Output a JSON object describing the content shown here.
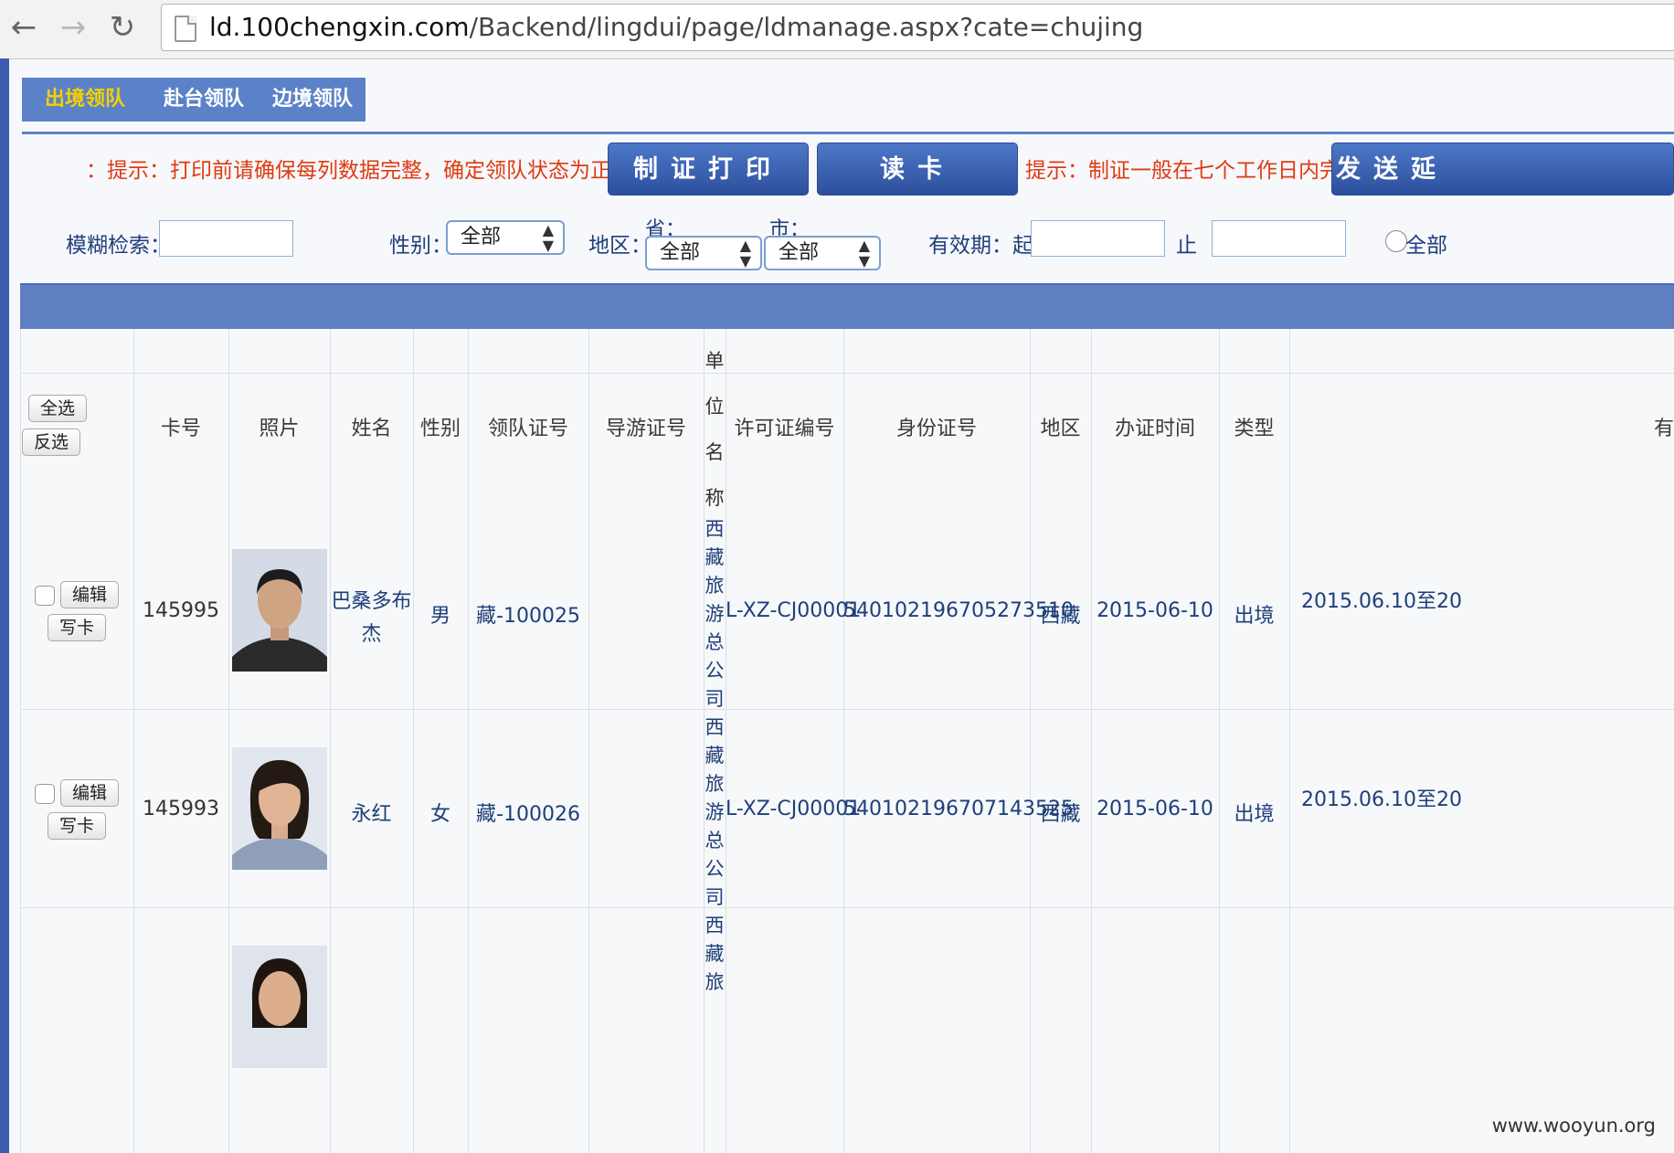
{
  "browser": {
    "back": "←",
    "forward": "→",
    "reload": "↻",
    "url_host": "ld.100chengxin.com",
    "url_path": "/Backend/lingdui/page/ldmanage.aspx?cate=chujing"
  },
  "tabs": [
    {
      "label": "出境领队",
      "active": true
    },
    {
      "label": "赴台领队",
      "active": false
    },
    {
      "label": "边境领队",
      "active": false
    }
  ],
  "tips": {
    "print_tip": "：提示：打印前请确保每列数据完整，确定领队状态为正常。",
    "make_tip": "提示：制证一般在七个工作日内完成"
  },
  "buttons": {
    "print_card": "制证打印",
    "read_card": "读卡",
    "send_delay": "发送延"
  },
  "filters": {
    "fuzzy_label": "模糊检索：",
    "gender_label": "性别：",
    "gender_value": "全部",
    "region_label": "地区：",
    "province_label": "省：",
    "province_value": "全部",
    "city_label": "市：",
    "city_value": "全部",
    "validity_label": "有效期：起",
    "until_label": "止",
    "all_radio_label": "全部"
  },
  "table": {
    "select_all": "全选",
    "invert": "反选",
    "headers": {
      "card_no": "卡号",
      "photo": "照片",
      "name": "姓名",
      "gender": "性别",
      "leader_cert": "领队证号",
      "guide_cert": "导游证号",
      "unit_chars": [
        "单",
        "位",
        "名",
        "称"
      ],
      "permit_no": "许可证编号",
      "id_no": "身份证号",
      "region": "地区",
      "issue_date": "办证时间",
      "type": "类型",
      "validity": "有"
    },
    "edit_label": "编辑",
    "write_label": "写卡",
    "rows": [
      {
        "card_no": "145995",
        "name_line1": "巴桑多布",
        "name_line2": "杰",
        "gender": "男",
        "leader_cert": "藏-100025",
        "unit_chars": [
          "西",
          "藏",
          "旅",
          "游",
          "总",
          "公",
          "司"
        ],
        "permit_no": "L-XZ-CJ00001",
        "id_no": "540102196705273510",
        "region": "西藏",
        "issue_date": "2015-06-10",
        "type": "出境",
        "validity": "2015.06.10至20"
      },
      {
        "card_no": "145993",
        "name_line1": "永红",
        "gender": "女",
        "leader_cert": "藏-100026",
        "unit_chars": [
          "西",
          "藏",
          "旅",
          "游",
          "总",
          "公",
          "司"
        ],
        "permit_no": "L-XZ-CJ00001",
        "id_no": "540102196707143525",
        "region": "西藏",
        "issue_date": "2015-06-10",
        "type": "出境",
        "validity": "2015.06.10至20"
      },
      {
        "unit_chars": [
          "西",
          "藏",
          "旅"
        ]
      }
    ]
  },
  "watermark": "www.wooyun.org"
}
